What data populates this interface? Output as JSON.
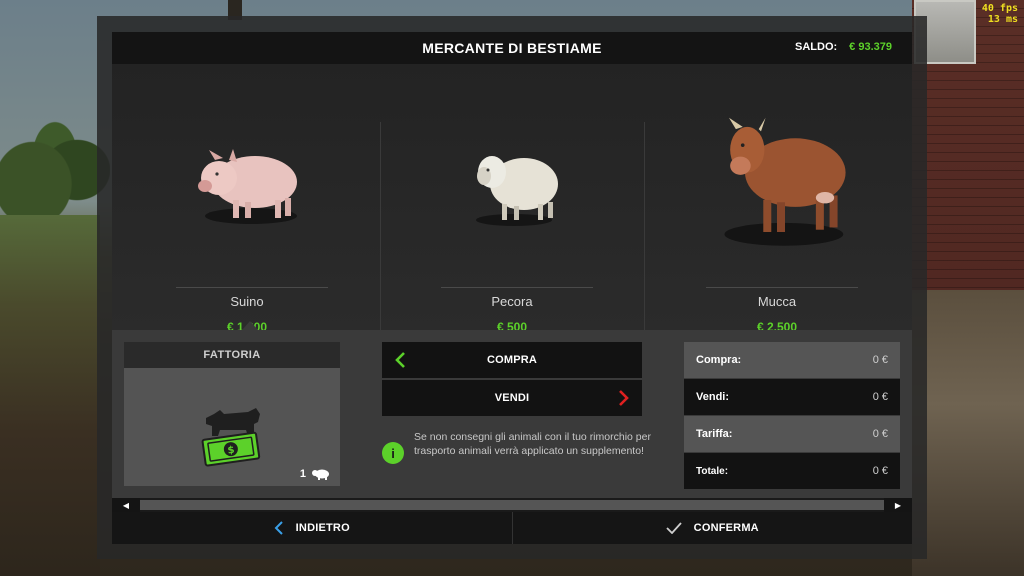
{
  "hud": {
    "fps": "40 fps",
    "ms": "13 ms"
  },
  "header": {
    "title": "MERCANTE DI BESTIAME",
    "balance_label": "SALDO:",
    "balance_value": "€ 93.379"
  },
  "animals": [
    {
      "name": "Suino",
      "price": "€ 1.600",
      "icon": "pig"
    },
    {
      "name": "Pecora",
      "price": "€ 500",
      "icon": "sheep"
    },
    {
      "name": "Mucca",
      "price": "€ 2.500",
      "icon": "cow"
    }
  ],
  "farm": {
    "title": "FATTORIA",
    "count": "1",
    "icon": "cow-money-icon"
  },
  "actions": {
    "buy_label": "COMPRA",
    "sell_label": "VENDI"
  },
  "info_text": "Se non consegni gli animali con il tuo rimorchio per trasporto animali verrà applicato un supplemento!",
  "summary": [
    {
      "label": "Compra:",
      "value": "0 €"
    },
    {
      "label": "Vendi:",
      "value": "0 €"
    },
    {
      "label": "Tariffa:",
      "value": "0 €"
    },
    {
      "label": "Totale:",
      "value": "0 €"
    }
  ],
  "footer": {
    "back_label": "INDIETRO",
    "confirm_label": "CONFERMA"
  },
  "colors": {
    "accent_green": "#5cd12a",
    "back_blue": "#3aa0e8",
    "sell_red": "#e02020"
  }
}
